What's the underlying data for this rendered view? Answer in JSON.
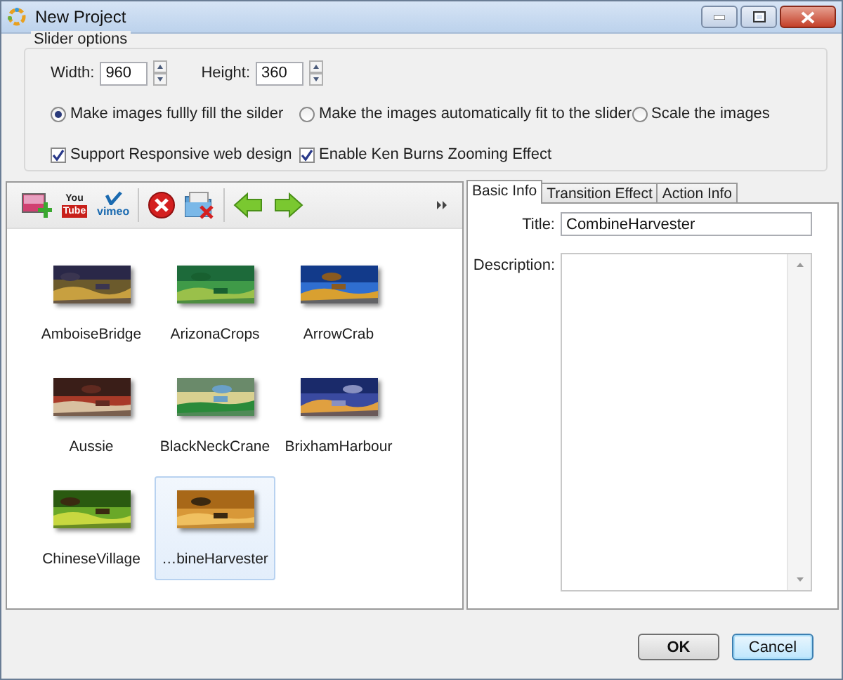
{
  "window": {
    "title": "New Project"
  },
  "slider_options": {
    "title": "Slider options",
    "width": {
      "label": "Width:",
      "value": "960"
    },
    "height": {
      "label": "Height:",
      "value": "360"
    },
    "fit_modes": [
      {
        "label": "Make images fullly fill the silder",
        "selected": true
      },
      {
        "label": "Make the images automatically fit to the slider",
        "selected": false
      },
      {
        "label": "Scale the images",
        "selected": false
      }
    ],
    "options": [
      {
        "label": "Support Responsive web design",
        "checked": true
      },
      {
        "label": "Enable Ken Burns Zooming Effect",
        "checked": true
      }
    ]
  },
  "toolbar": {
    "youtube_logo": [
      "You",
      "Tube"
    ],
    "vimeo_logo": "vimeo"
  },
  "images": [
    {
      "label": "AmboiseBridge",
      "selected": false
    },
    {
      "label": "ArizonaCrops",
      "selected": false
    },
    {
      "label": "ArrowCrab",
      "selected": false
    },
    {
      "label": "Aussie",
      "selected": false
    },
    {
      "label": "BlackNeckCrane",
      "selected": false
    },
    {
      "label": "BrixhamHarbour",
      "selected": false
    },
    {
      "label": "ChineseVillage",
      "selected": false
    },
    {
      "label": "…bineHarvester",
      "selected": true
    }
  ],
  "tabs": [
    {
      "label": "Basic Info",
      "selected": true
    },
    {
      "label": "Transition Effect",
      "selected": false
    },
    {
      "label": "Action Info",
      "selected": false
    }
  ],
  "basic_info": {
    "title": {
      "label": "Title:",
      "value": "CombineHarvester"
    },
    "description": {
      "label": "Description:"
    }
  },
  "buttons": [
    {
      "label": "OK",
      "kind": "default"
    },
    {
      "label": "Cancel",
      "kind": "focused"
    }
  ]
}
